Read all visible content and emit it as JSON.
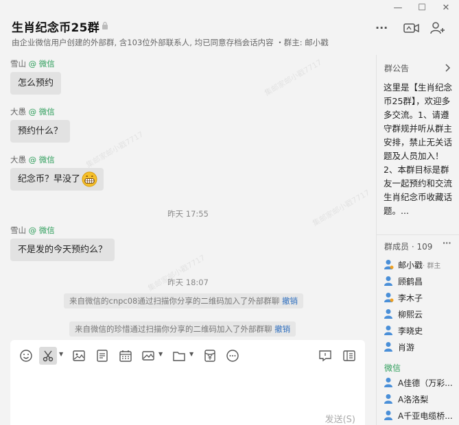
{
  "window": {
    "minimize_glyph": "—",
    "maximize_glyph": "☐",
    "close_glyph": "✕"
  },
  "header": {
    "title": "生肖纪念币25群",
    "subtitle": "由企业微信用户创建的外部群, 含103位外部联系人, 均已同意存档会话内容 ・群主: 邮小戳",
    "more_glyph": "···"
  },
  "chat": {
    "messages": [
      {
        "sender": "雪山",
        "source": "@ 微信",
        "text": "怎么预约"
      },
      {
        "sender": "大愚",
        "source": "@ 微信",
        "text": "预约什么？"
      },
      {
        "sender": "大愚",
        "source": "@ 微信",
        "text": "纪念币？早没了"
      },
      {
        "sender": "雪山",
        "source": "@ 微信",
        "text": "不是发的今天预约么？"
      }
    ],
    "timestamps": [
      "昨天 17:55",
      "昨天 18:07"
    ],
    "system_notes": [
      {
        "text": "来自微信的cnpc08通过扫描你分享的二维码加入了外部群聊",
        "action": "撤销"
      },
      {
        "text": "来自微信的珍惜通过扫描你分享的二维码加入了外部群聊",
        "action": "撤销"
      }
    ],
    "watermark": "集邮家邮小戳7717"
  },
  "composer": {
    "send_label": "发送(S)"
  },
  "sidebar": {
    "notice_title": "群公告",
    "notice_text": "这里是【生肖纪念币25群】，欢迎多多交流。1、请遵守群规并听从群主安排，禁止无关话题及人员加入！2、本群目标是群友一起预约和交流生肖纪念币收藏话题。...",
    "members_title": "群成员 · 109",
    "more_glyph": "···",
    "members": [
      {
        "name": "邮小戳",
        "tag": "· 群主"
      },
      {
        "name": "顾鹤昌",
        "tag": ""
      },
      {
        "name": "李木子",
        "tag": ""
      },
      {
        "name": "柳熙云",
        "tag": ""
      },
      {
        "name": "李晓史",
        "tag": ""
      },
      {
        "name": "肖游",
        "tag": ""
      }
    ],
    "wechat_section": "微信",
    "wechat_members": [
      {
        "name": "A佳德（万彩..."
      },
      {
        "name": "A洛洛梨"
      },
      {
        "name": "A千亚电缆桥..."
      }
    ]
  },
  "colors": {
    "accent_blue": "#2f6fbf",
    "wechat_green": "#2e9e5b",
    "bubble_gray": "#e2e2e2"
  }
}
